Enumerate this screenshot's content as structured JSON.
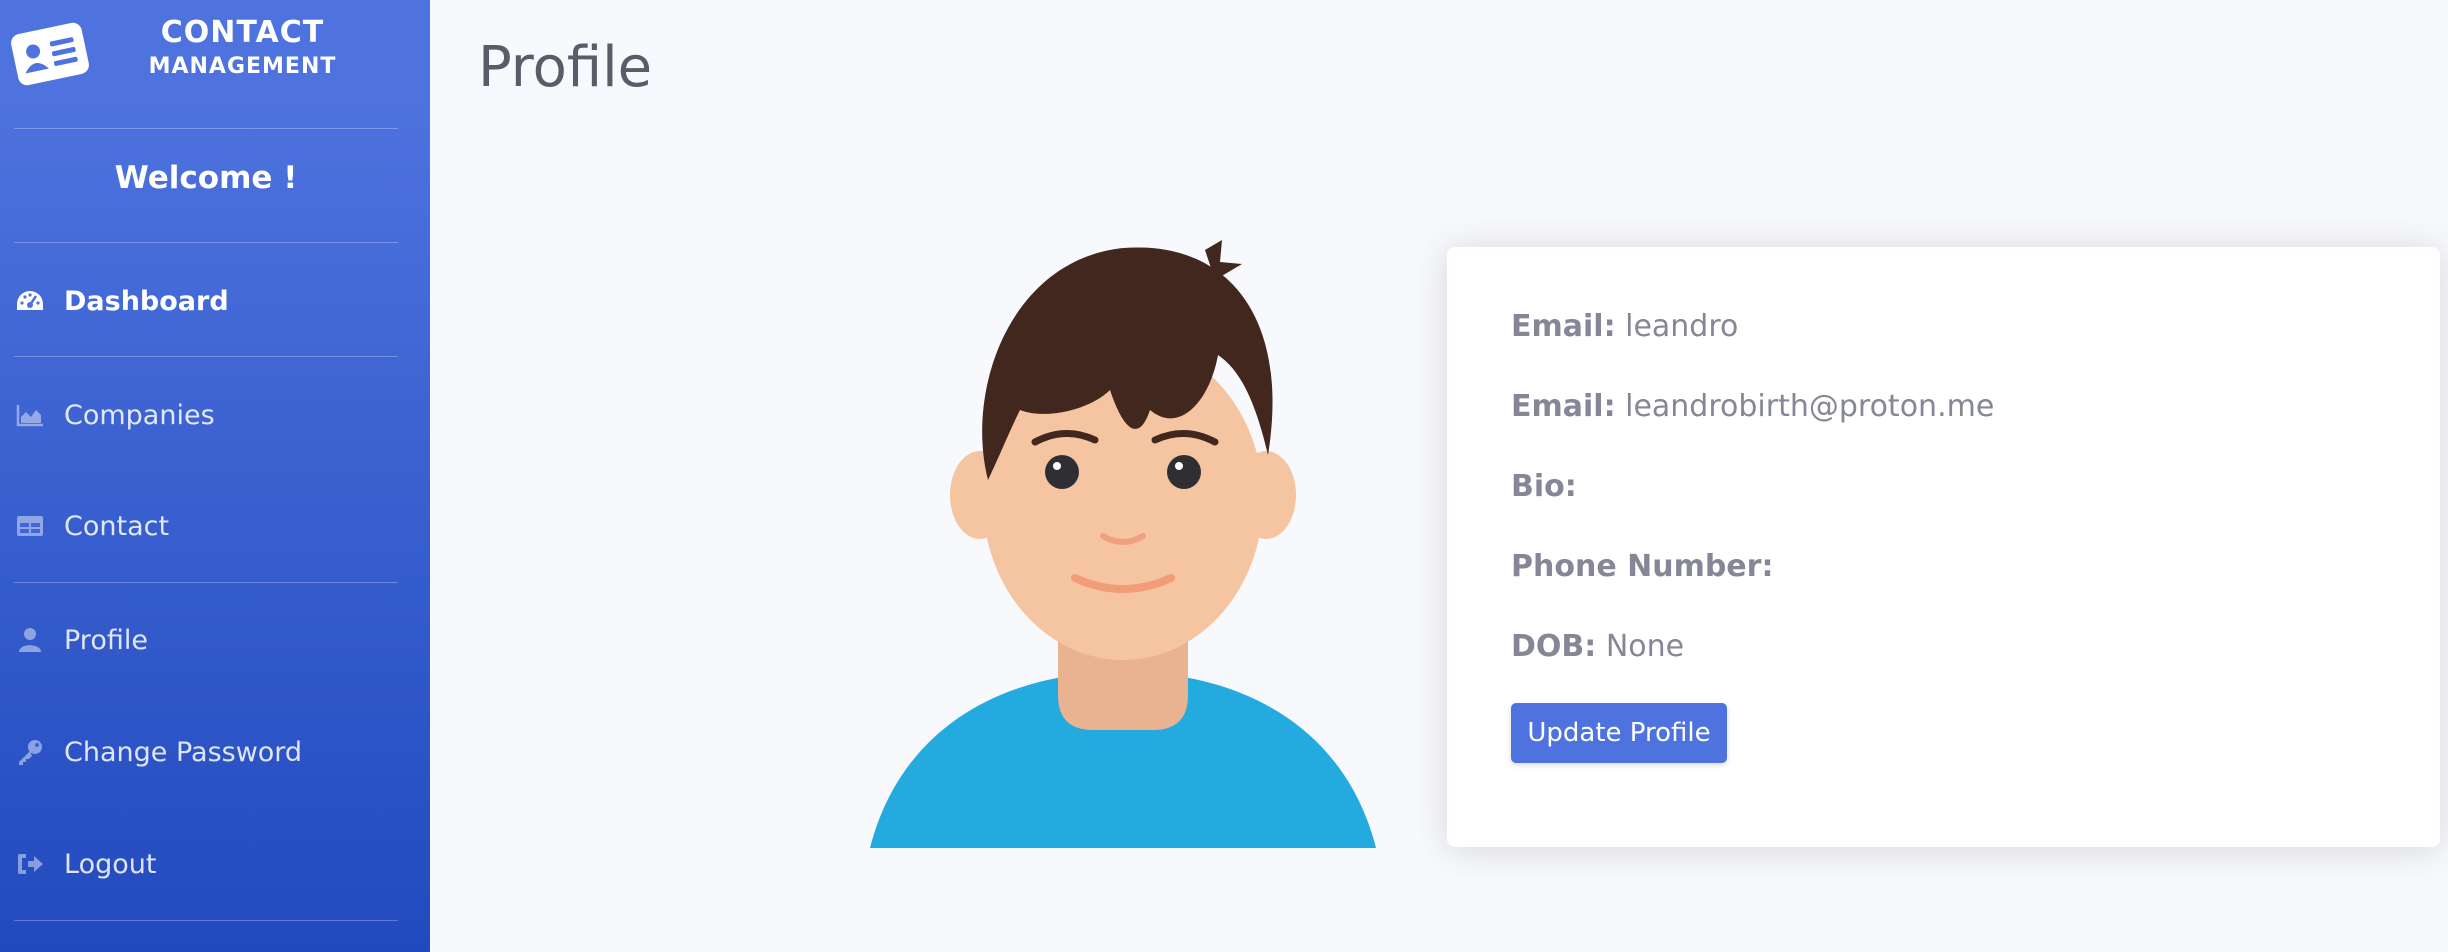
{
  "brand": {
    "line1": "CONTACT",
    "line2": "MANAGEMENT",
    "icon": "contact-card-icon"
  },
  "sidebar": {
    "welcome": "Welcome !",
    "items": [
      {
        "label": "Dashboard",
        "icon": "dashboard-gauge-icon",
        "active": true
      },
      {
        "label": "Companies",
        "icon": "area-chart-icon",
        "active": false
      },
      {
        "label": "Contact",
        "icon": "table-icon",
        "active": false
      },
      {
        "label": "Profile",
        "icon": "user-icon",
        "active": false
      },
      {
        "label": "Change Password",
        "icon": "key-icon",
        "active": false
      },
      {
        "label": "Logout",
        "icon": "sign-out-icon",
        "active": false
      }
    ]
  },
  "main": {
    "title": "Profile",
    "profile": {
      "fields": [
        {
          "label": "Email:",
          "value": "leandro"
        },
        {
          "label": "Email:",
          "value": "leandrobirth@proton.me"
        },
        {
          "label": "Bio:",
          "value": ""
        },
        {
          "label": "Phone Number:",
          "value": ""
        },
        {
          "label": "DOB:",
          "value": "None"
        }
      ],
      "update_button": "Update Profile"
    }
  },
  "colors": {
    "sidebar_top": "#4e73df",
    "sidebar_bottom": "#224abe",
    "button": "#4e73df",
    "page_bg": "#f8f9fc",
    "text_muted": "#858796"
  }
}
